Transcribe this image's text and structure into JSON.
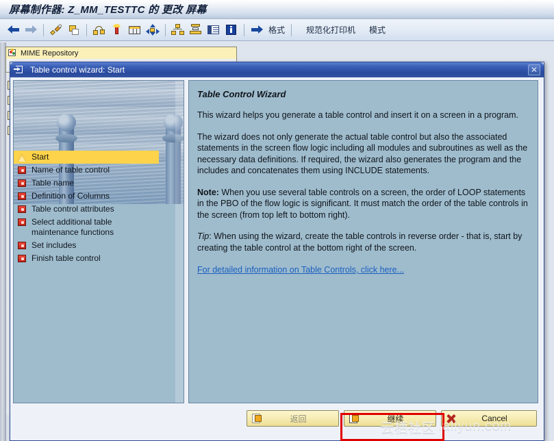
{
  "window": {
    "title": "屏幕制作器: Z_MM_TESTTC 的 更改 屏幕"
  },
  "toolbar": {
    "icons": [
      {
        "name": "back-arrow-icon",
        "glyph": "arrow-left"
      },
      {
        "name": "forward-arrow-icon",
        "glyph": "arrow-right"
      },
      {
        "name": "edit-pencil-icon",
        "glyph": "pencil"
      },
      {
        "name": "copy-icon",
        "glyph": "copy"
      },
      {
        "name": "flow-logic-icon",
        "glyph": "flow"
      },
      {
        "name": "element-list-icon",
        "glyph": "lamp"
      },
      {
        "name": "table-control-icon",
        "glyph": "table"
      },
      {
        "name": "arrange-icon",
        "glyph": "arrows"
      },
      {
        "name": "hierarchy-icon",
        "glyph": "hierarchy"
      },
      {
        "name": "stack-icon",
        "glyph": "stack"
      },
      {
        "name": "grid-icon",
        "glyph": "grid"
      },
      {
        "name": "info-icon",
        "glyph": "info"
      }
    ],
    "format_label": "格式",
    "printer_label": "规范化打印机",
    "mode_label": "模式"
  },
  "mime_tab": {
    "label": "MIME Repository"
  },
  "dialog": {
    "title": "Table control wizard: Start",
    "close_label": "✕",
    "steps": [
      {
        "label": "Start",
        "active": true
      },
      {
        "label": "Name of table control",
        "active": false
      },
      {
        "label": "Table name",
        "active": false
      },
      {
        "label": "Definition of Columns",
        "active": false
      },
      {
        "label": "Table control attributes",
        "active": false
      },
      {
        "label": "Select additional table\nmaintenance functions",
        "active": false
      },
      {
        "label": "Set includes",
        "active": false
      },
      {
        "label": "Finish table control",
        "active": false
      }
    ],
    "content": {
      "heading": "Table Control Wizard",
      "p1": "This wizard helps you generate a table control and insert it on a screen in a program.",
      "p2": "The wizard does not only generate the actual table control but also the associated statements in the screen flow logic including all modules and subroutines as well as the necessary data definitions. If required, the wizard also generates the program and the includes and concatenates them using INCLUDE statements.",
      "note_label": "Note:",
      "note_text": " When you use several table controls on a screen, the order of LOOP statements in the PBO of the flow logic is significant. It must match the order of the table controls in the screen (from top left to bottom right).",
      "tip_label": "Tip",
      "tip_text": ": When using the wizard, create the table controls in reverse order - that is, start by creating the table control at the bottom right of the screen.",
      "link": "For detailed information on Table Controls, click here..."
    },
    "buttons": {
      "back": "返回",
      "continue": "继续",
      "cancel": "Cancel"
    }
  },
  "watermark": {
    "cn": "云栖社区",
    "en": ".aliyun.com"
  },
  "colors": {
    "title_accent": "#2a4a9e",
    "content_bg": "#9fbccd",
    "step_active_bg": "#fcd34a",
    "button_bg": "#f6ecb3",
    "highlight_border": "#e00000",
    "link": "#1a5fbf"
  }
}
